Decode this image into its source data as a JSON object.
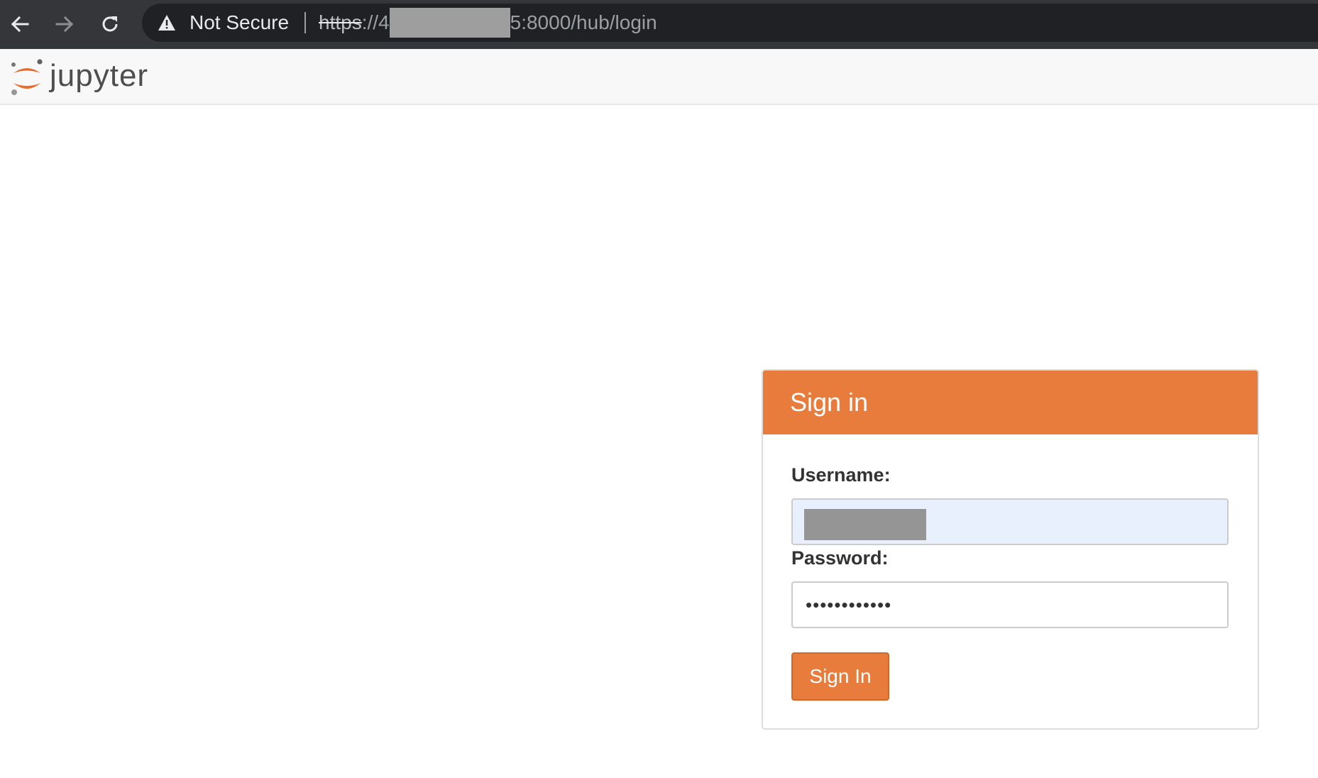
{
  "browser": {
    "security_label": "Not Secure",
    "url_scheme": "https",
    "url_sep": "://",
    "url_prefix_visible": "4",
    "url_suffix_visible": "5",
    "url_rest": ":8000/hub/login"
  },
  "header": {
    "brand": "jupyter"
  },
  "login": {
    "heading": "Sign in",
    "username_label": "Username:",
    "password_label": "Password:",
    "password_value": "••••••••••••",
    "submit_label": "Sign In"
  },
  "colors": {
    "accent": "#e77c3d",
    "chrome_bg": "#35363a",
    "omnibox_bg": "#202124",
    "autofill_bg": "#e8f0fe"
  },
  "icons": {
    "back": "arrow-left-icon",
    "forward": "arrow-right-icon",
    "reload": "reload-icon",
    "security": "warning-triangle-icon",
    "brand": "jupyter-logo"
  }
}
